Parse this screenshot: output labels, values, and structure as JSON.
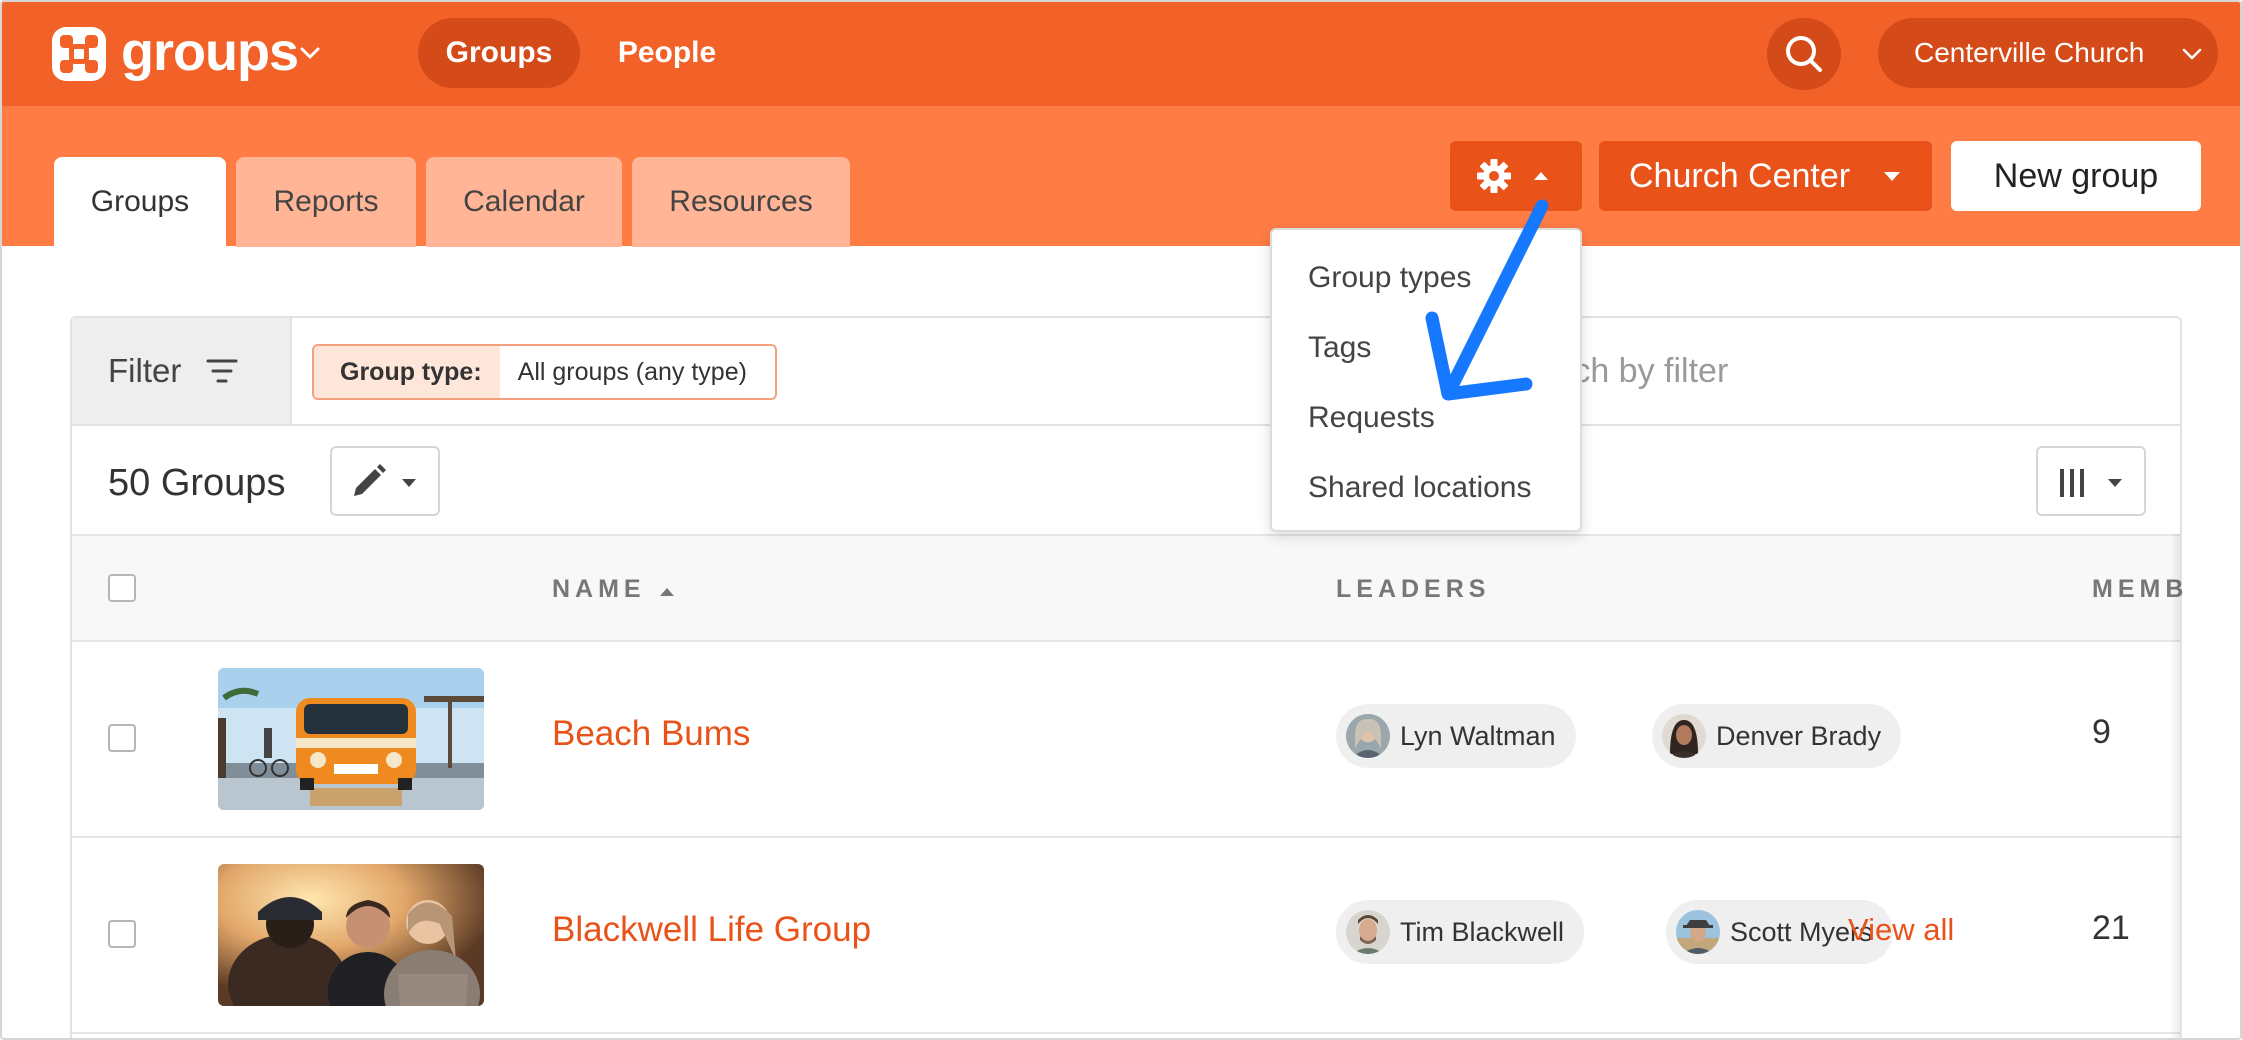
{
  "app": {
    "name": "groups",
    "accent": "#f26127",
    "subheader_color": "#ff7c45"
  },
  "topnav": {
    "items": [
      {
        "label": "Groups",
        "active": true
      },
      {
        "label": "People",
        "active": false
      }
    ],
    "organization": "Centerville Church"
  },
  "tabs": [
    {
      "label": "Groups",
      "active": true
    },
    {
      "label": "Reports",
      "active": false
    },
    {
      "label": "Calendar",
      "active": false
    },
    {
      "label": "Resources",
      "active": false
    }
  ],
  "toolbar": {
    "settings_icon": "gear-icon",
    "church_center_label": "Church Center",
    "new_group_label": "New group"
  },
  "settings_menu": {
    "open": true,
    "items": [
      "Group types",
      "Tags",
      "Requests",
      "Shared locations"
    ]
  },
  "filter": {
    "label": "Filter",
    "chip_key": "Group type:",
    "chip_value": "All groups (any type)",
    "search_text": "rch by filter"
  },
  "list": {
    "count_label": "50 Groups",
    "columns": [
      "NAME",
      "LEADERS",
      "MEMB"
    ],
    "rows": [
      {
        "name": "Beach Bums",
        "leaders": [
          "Lyn Waltman",
          "Denver Brady"
        ],
        "view_all": "",
        "members": "9"
      },
      {
        "name": "Blackwell Life Group",
        "leaders": [
          "Tim Blackwell",
          "Scott Myers"
        ],
        "view_all": "View all",
        "members": "21"
      }
    ]
  },
  "annotation": {
    "arrow_color": "#1677ff"
  }
}
